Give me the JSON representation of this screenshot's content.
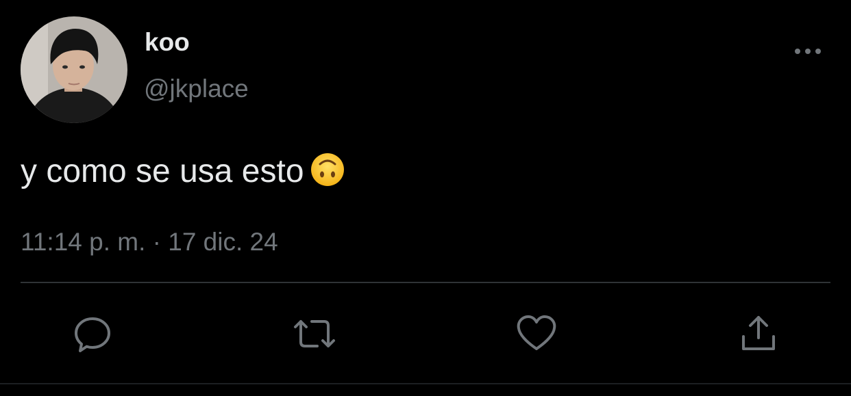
{
  "author": {
    "display_name": "koo",
    "handle": "@jkplace"
  },
  "tweet": {
    "text": "y como se usa esto",
    "emoji": "upside-down-face-emoji",
    "timestamp": "11:14 p. m. · 17 dic. 24"
  },
  "actions": [
    {
      "icon": "reply-icon"
    },
    {
      "icon": "retweet-icon"
    },
    {
      "icon": "like-icon"
    },
    {
      "icon": "share-icon"
    }
  ],
  "colors": {
    "background": "#000000",
    "primary_text": "#e7e9ea",
    "secondary_text": "#71767b",
    "divider": "#2f3336",
    "emoji_yellow": "#ffcc33"
  }
}
